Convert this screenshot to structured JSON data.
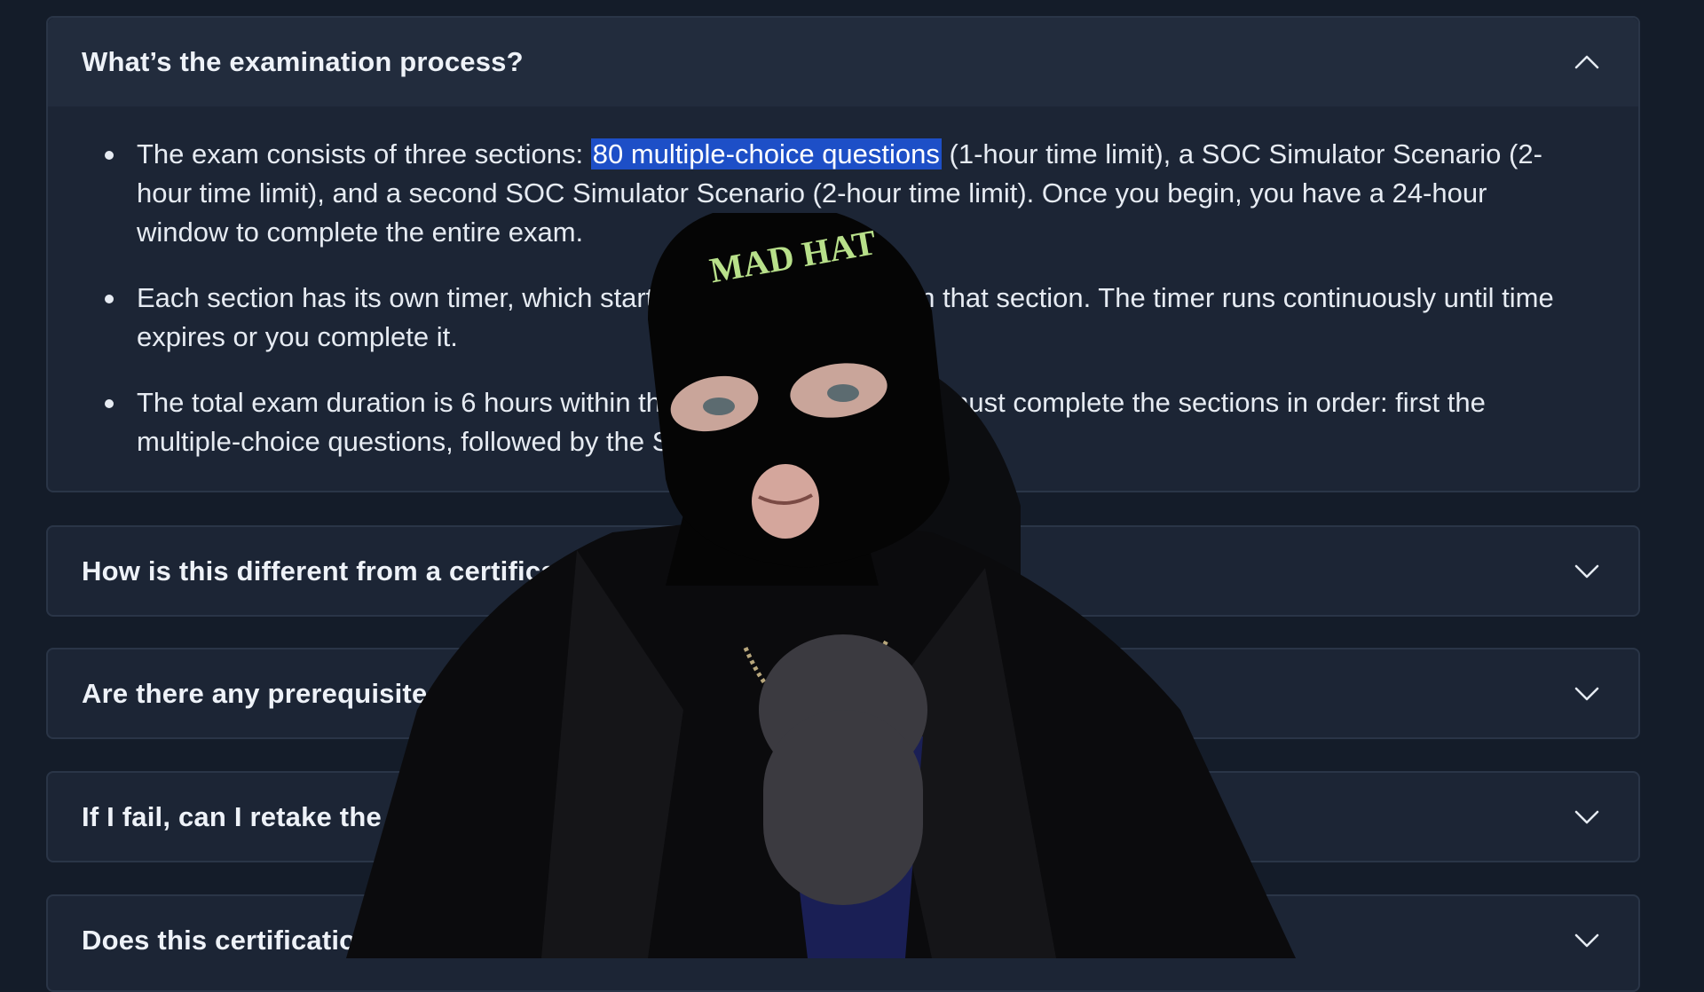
{
  "faq": [
    {
      "question": "What’s the examination process?",
      "expanded": true,
      "bullets": [
        {
          "before": "The exam consists of three sections: ",
          "highlight": "80 multiple-choice questions",
          "after": " (1-hour time limit), a SOC Simulator Scenario (2-hour time limit), and a second SOC Simulator Scenario (2-hour time limit). Once you begin, you have a 24-hour window to complete the entire exam."
        },
        {
          "before": "Each section has its own timer, which starts as soon as you begin that section. The timer runs continuously until time expires or you complete it."
        },
        {
          "before": "The total exam duration is 6 hours within the 24-hour window. You must complete the sections in order: first the multiple-choice questions, followed by the SOC Simulator Scenarios."
        }
      ]
    },
    {
      "question": "How is this different from a certificate of completion?",
      "expanded": false
    },
    {
      "question": "Are there any prerequisites?",
      "expanded": false
    },
    {
      "question": "If I fail, can I retake the exam?",
      "expanded": false
    },
    {
      "question": "Does this certification expire?",
      "expanded": false
    }
  ],
  "overlay": {
    "beanie_text": "MAD HAT"
  },
  "colors": {
    "background": "#141c29",
    "panel": "#1c2535",
    "highlight": "#1d4fc7"
  },
  "icons": {
    "expanded": "chevron-up-icon",
    "collapsed": "chevron-down-icon"
  }
}
